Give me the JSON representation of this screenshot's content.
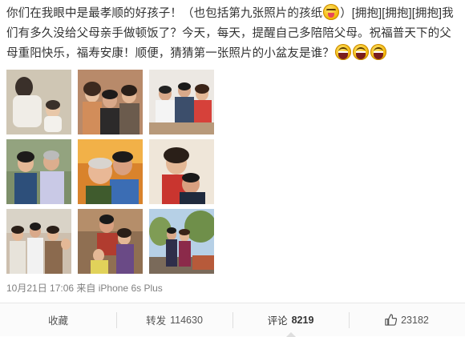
{
  "post": {
    "text_1": "你们在我眼中是最孝顺的好孩子！（也包括第九张照片的孩纸",
    "text_2": "）[拥抱][拥抱][拥抱]我们有多久没给父母亲手做顿饭了？今天，每天，提醒自己多陪陪父母。祝福普天下的父母重阳快乐，福寿安康！顺便，猜猜第一张照片的小盆友是谁？",
    "emoji_1": "tongue-out-emoji",
    "emoji_tail": [
      "laughing-emoji",
      "laughing-emoji",
      "laughing-emoji"
    ]
  },
  "photos": [
    {
      "name": "photo-1",
      "desc": "old-photo-mother-with-child"
    },
    {
      "name": "photo-2",
      "desc": "family-group"
    },
    {
      "name": "photo-3",
      "desc": "family-at-table"
    },
    {
      "name": "photo-4",
      "desc": "couple-portrait"
    },
    {
      "name": "photo-5",
      "desc": "father-and-son-hug"
    },
    {
      "name": "photo-6",
      "desc": "mother-and-son"
    },
    {
      "name": "photo-7",
      "desc": "family-group-outdoor"
    },
    {
      "name": "photo-8",
      "desc": "family-indoor"
    },
    {
      "name": "photo-9",
      "desc": "couple-in-garden"
    }
  ],
  "meta": {
    "time": "10月21日 17:06",
    "source": "来自 iPhone 6s Plus"
  },
  "actions": {
    "favorite": {
      "label": "收藏"
    },
    "repost": {
      "label": "转发",
      "count": "114630"
    },
    "comment": {
      "label": "评论",
      "count": "8219"
    },
    "like": {
      "icon": "thumbs-up-icon",
      "count": "23182"
    }
  }
}
